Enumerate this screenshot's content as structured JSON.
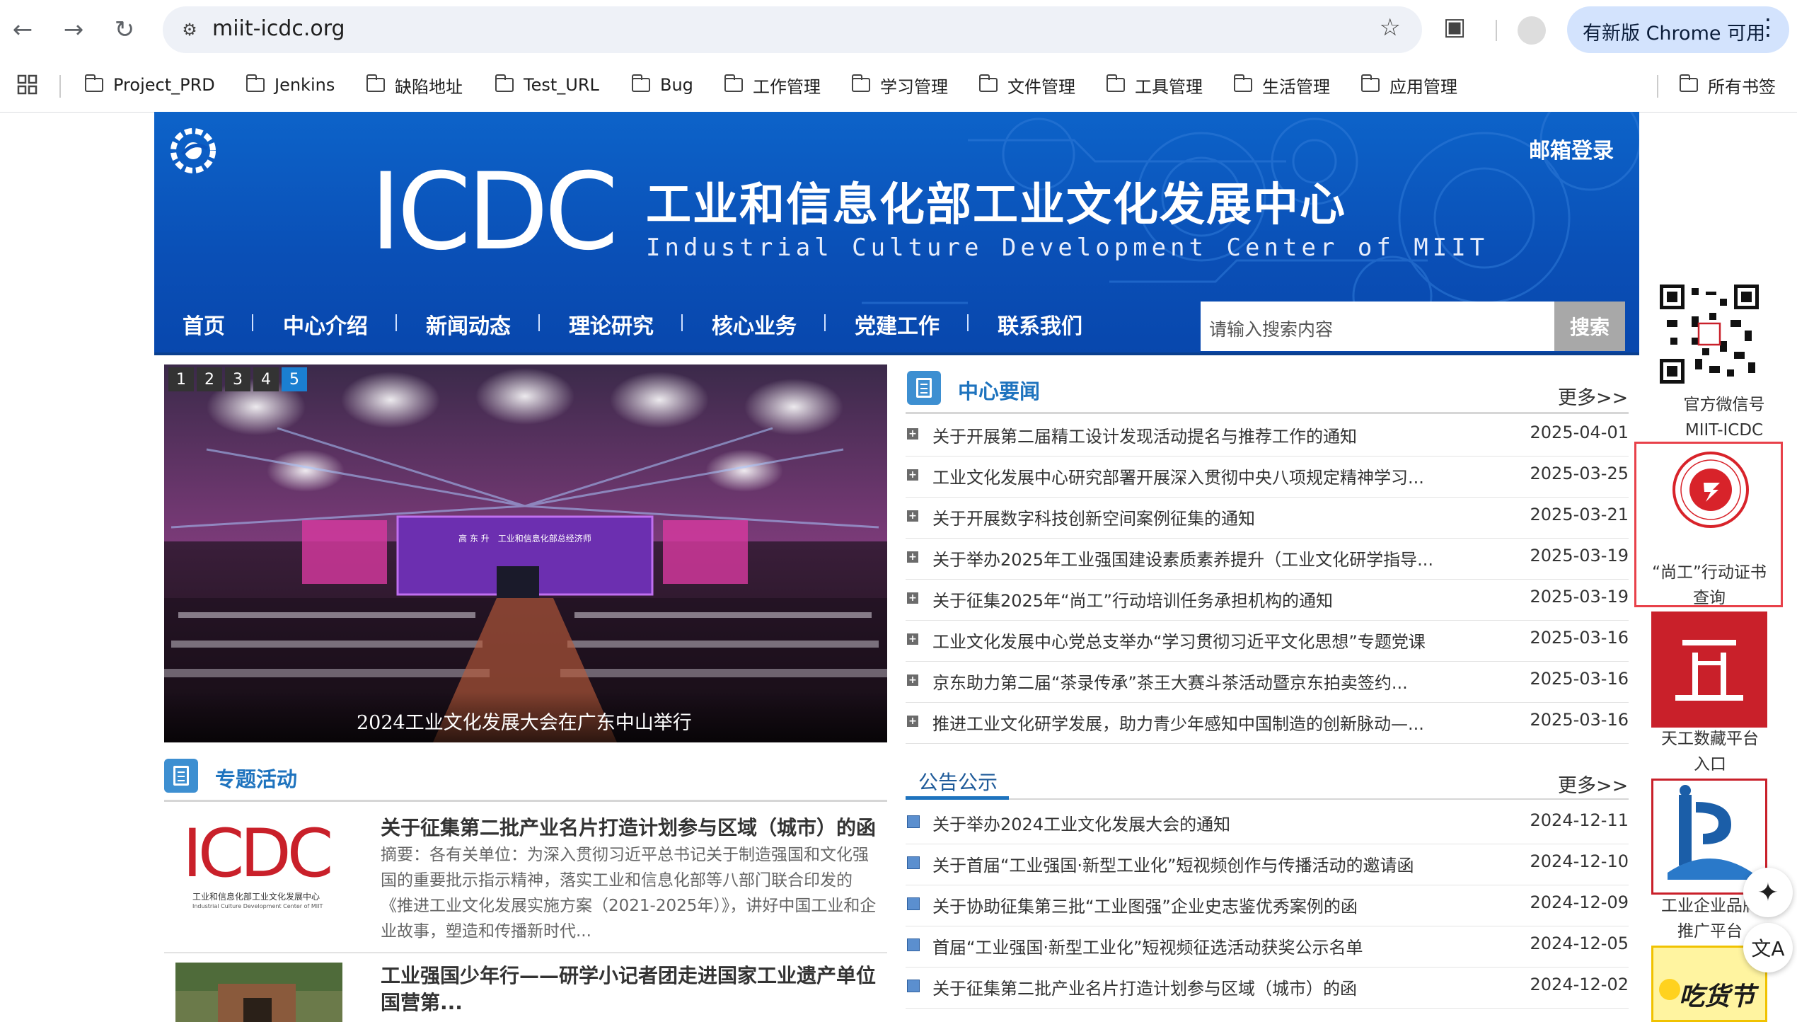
{
  "browser": {
    "url": "miit-icdc.org",
    "update_chip": "有新版 Chrome 可用",
    "bookmarks": [
      "Project_PRD",
      "Jenkins",
      "缺陷地址",
      "Test_URL",
      "Bug",
      "工作管理",
      "学习管理",
      "文件管理",
      "工具管理",
      "生活管理",
      "应用管理"
    ],
    "all_bookmarks": "所有书签"
  },
  "header": {
    "logo_text": "ICDC",
    "title_cn": "工业和信息化部工业文化发展中心",
    "title_en": "Industrial Culture Development Center of MIIT",
    "mail_login": "邮箱登录",
    "nav": [
      "首页",
      "中心介绍",
      "新闻动态",
      "理论研究",
      "核心业务",
      "党建工作",
      "联系我们"
    ],
    "search_placeholder": "请输入搜索内容",
    "search_button": "搜索"
  },
  "carousel": {
    "slides": [
      "1",
      "2",
      "3",
      "4",
      "5"
    ],
    "active": "5",
    "caption": "2024工业文化发展大会在广东中山举行",
    "screen_text": "高 东 升　工业和信息化部总经济师"
  },
  "center_news": {
    "title": "中心要闻",
    "more": "更多>>",
    "items": [
      {
        "title": "关于开展第二届精工设计发现活动提名与推荐工作的通知",
        "date": "2025-04-01"
      },
      {
        "title": "工业文化发展中心研究部署开展深入贯彻中央八项规定精神学习...",
        "date": "2025-03-25"
      },
      {
        "title": "关于开展数字科技创新空间案例征集的通知",
        "date": "2025-03-21"
      },
      {
        "title": "关于举办2025年工业强国建设素质素养提升（工业文化研学指导...",
        "date": "2025-03-19"
      },
      {
        "title": "关于征集2025年“尚工”行动培训任务承担机构的通知",
        "date": "2025-03-19"
      },
      {
        "title": "工业文化发展中心党总支举办“学习贯彻习近平文化思想”专题党课",
        "date": "2025-03-16"
      },
      {
        "title": "京东助力第二届“茶录传承”茶王大赛斗茶活动暨京东拍卖签约...",
        "date": "2025-03-16"
      },
      {
        "title": "推进工业文化研学发展，助力青少年感知中国制造的创新脉动—...",
        "date": "2025-03-16"
      }
    ]
  },
  "special": {
    "title": "专题活动",
    "items": [
      {
        "title": "关于征集第二批产业名片打造计划参与区域（城市）的函",
        "summary": "摘要：各有关单位：为深入贯彻习近平总书记关于制造强国和文化强国的重要批示指示精神，落实工业和信息化部等八部门联合印发的《推进工业文化发展实施方案（2021-2025年）》，讲好中国工业和企业故事，塑造和传播新时代...",
        "thumb_logo": "ICDC",
        "thumb_cn": "工业和信息化部工业文化发展中心",
        "thumb_en": "Industrial Culture Development Center of MIIT"
      },
      {
        "title": "工业强国少年行——研学小记者团走进国家工业遗产单位国营第...",
        "summary": ""
      }
    ]
  },
  "notices": {
    "title": "公告公示",
    "more": "更多>>",
    "items": [
      {
        "title": "关于举办2024工业文化发展大会的通知",
        "date": "2024-12-11"
      },
      {
        "title": "关于首届“工业强国·新型工业化”短视频创作与传播活动的邀请函",
        "date": "2024-12-10"
      },
      {
        "title": "关于协助征集第三批“工业图强”企业史志鉴优秀案例的函",
        "date": "2024-12-09"
      },
      {
        "title": "首届“工业强国·新型工业化”短视频征选活动获奖公示名单",
        "date": "2024-12-05"
      },
      {
        "title": "关于征集第二批产业名片打造计划参与区域（城市）的函",
        "date": "2024-12-02"
      }
    ]
  },
  "rail": {
    "wechat": "官方微信号\nMIIT-ICDC",
    "wechat_1": "官方微信号",
    "wechat_2": "MIIT-ICDC",
    "shanggong_1": "“尚工”行动证书",
    "shanggong_2": "查询",
    "tiangong_1": "天工数藏平台",
    "tiangong_2": "入口",
    "enterprise_1": "工业企业品牌",
    "enterprise_2": "推广平台",
    "foodie": "吃货节"
  },
  "colors": {
    "banner_blue": "#0a54bd",
    "link_blue": "#1e73be",
    "highlight_red": "#e8414a",
    "chrome_chip": "#d3e3fd"
  }
}
